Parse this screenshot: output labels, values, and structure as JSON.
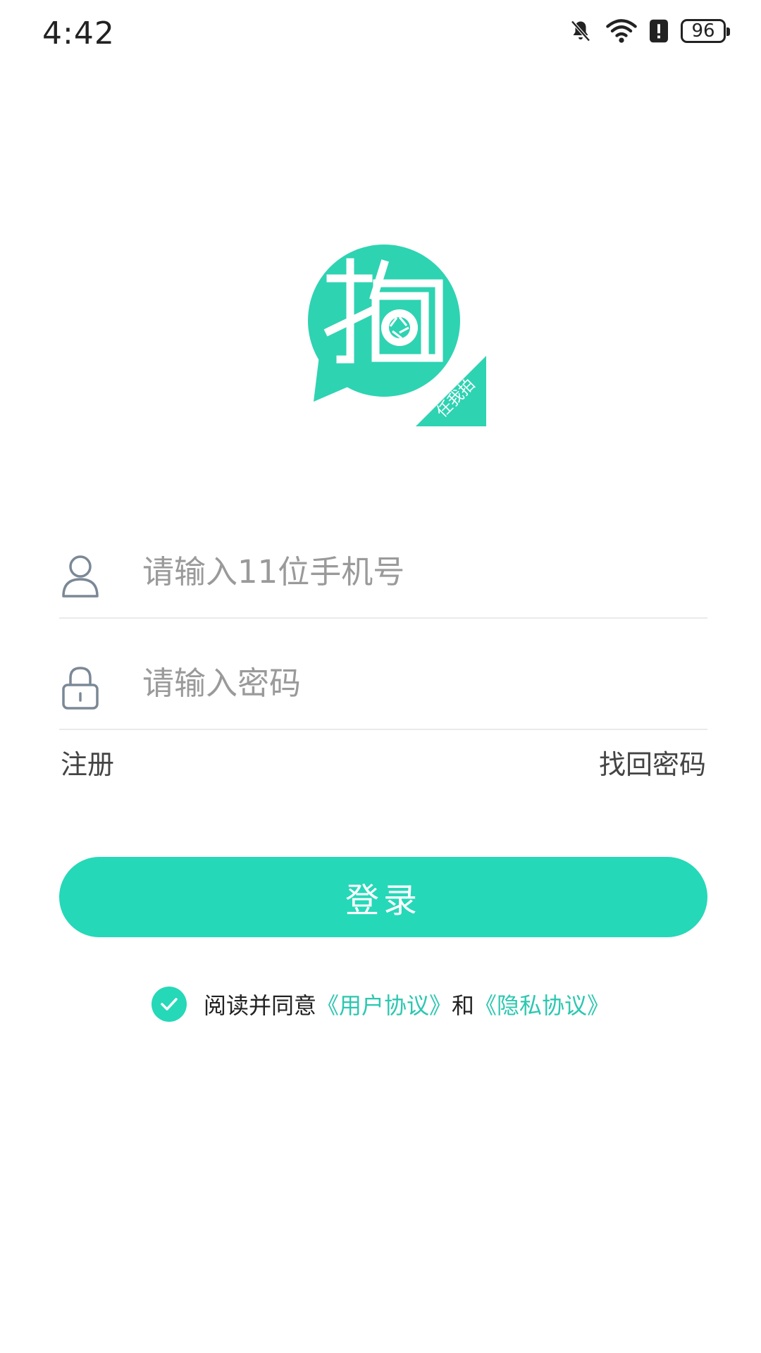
{
  "status_bar": {
    "time": "4:42",
    "battery": "96"
  },
  "logo": {
    "main_char": "拍",
    "ribbon_text": "任我拍"
  },
  "form": {
    "phone": {
      "placeholder": "请输入11位手机号",
      "value": ""
    },
    "password": {
      "placeholder": "请输入密码",
      "value": ""
    }
  },
  "links": {
    "register": "注册",
    "forgot_password": "找回密码"
  },
  "login_button": "登录",
  "agreement": {
    "checked": true,
    "prefix": "阅读并同意",
    "user_agreement": "《用户协议》",
    "and": "和",
    "privacy_policy": "《隐私协议》"
  },
  "colors": {
    "accent": "#25d8b8",
    "link": "#2cc7b0",
    "icon": "#7b8896"
  }
}
